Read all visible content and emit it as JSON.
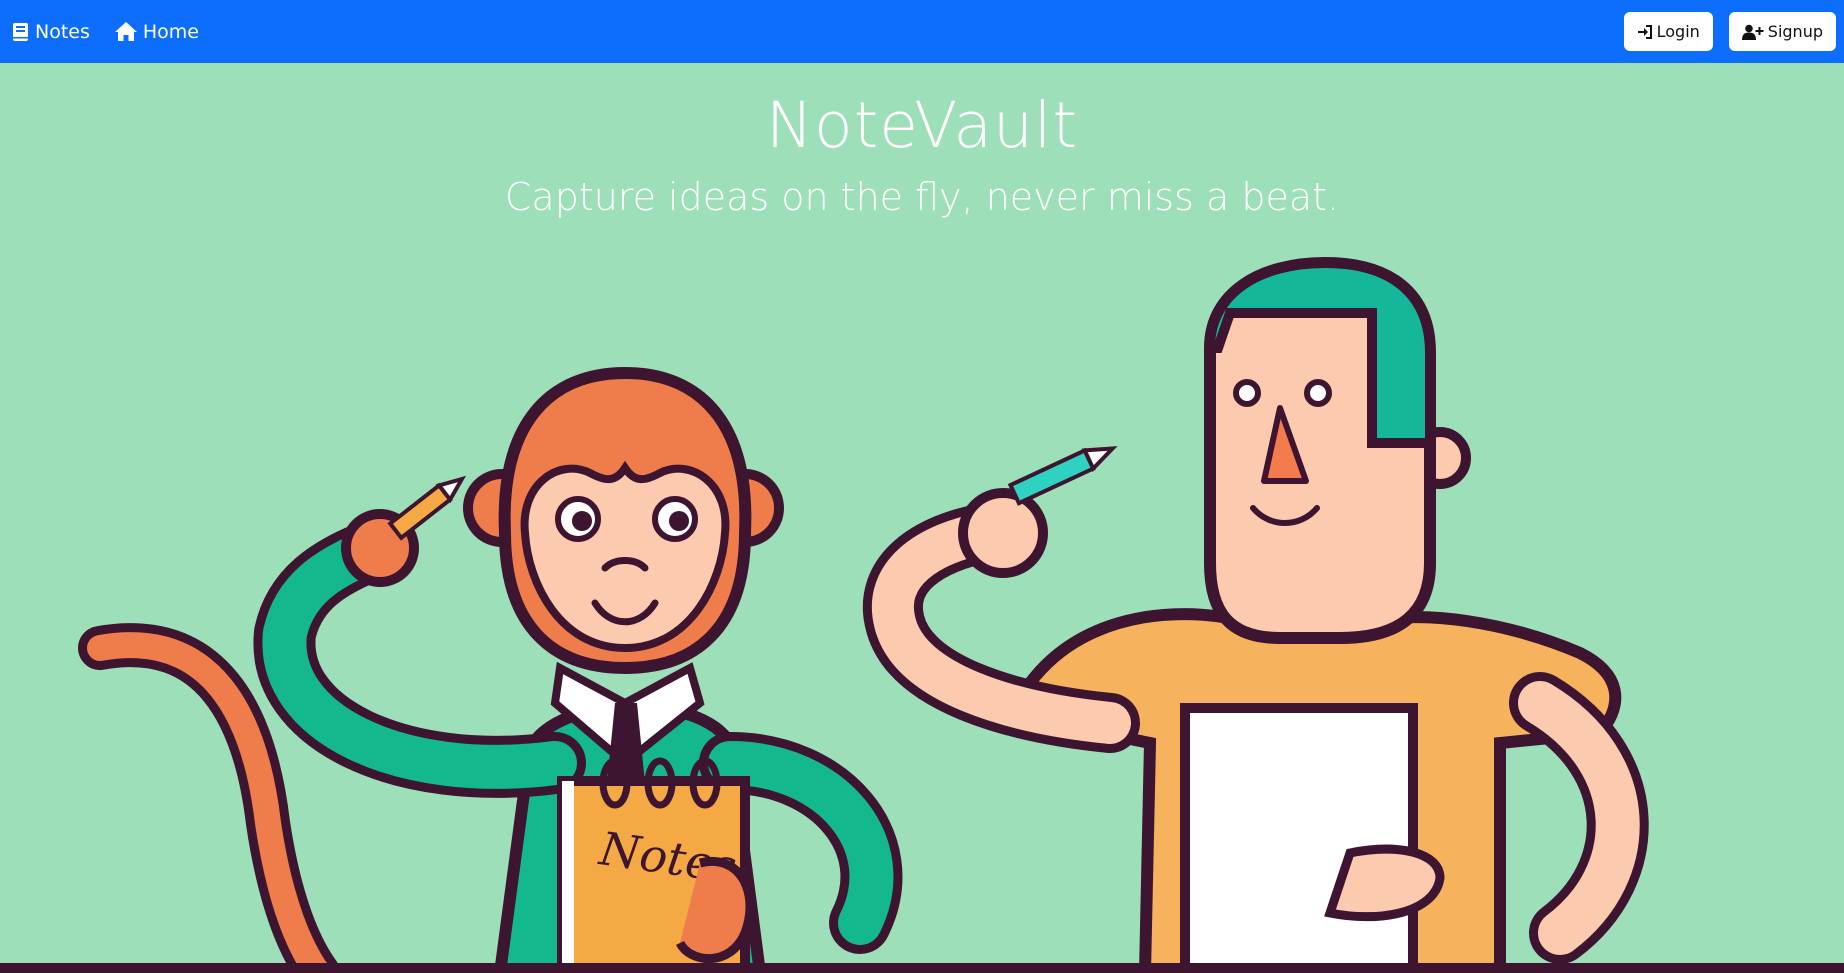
{
  "navbar": {
    "brand_label": "Notes",
    "home_label": "Home",
    "login_label": "Login",
    "signup_label": "Signup",
    "background": "#0d6efd"
  },
  "hero": {
    "title": "NoteVault",
    "tagline": "Capture ideas on the fly, never miss a beat.",
    "background": "#9ddfb8",
    "illustration": {
      "description_icon": "monkey-and-man-taking-notes-illustration",
      "notepad_text": "Notes"
    }
  }
}
